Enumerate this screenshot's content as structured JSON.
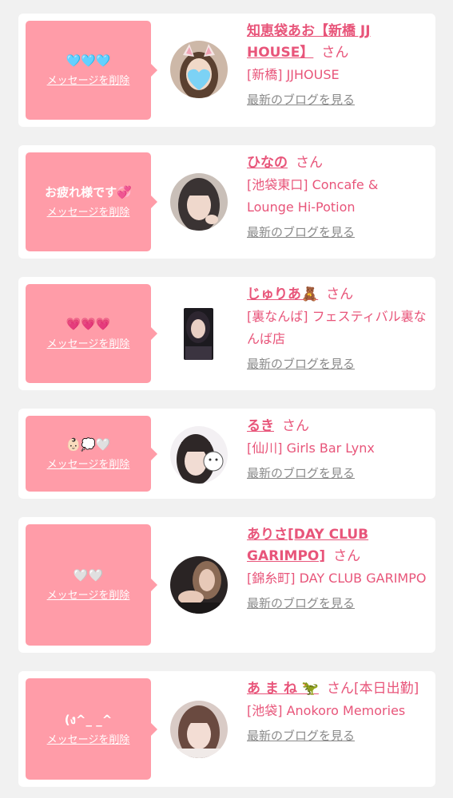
{
  "colors": {
    "accent_pink": "#e8557a",
    "bubble_pink": "#ff9ca8",
    "page_bg": "#f1f1f1",
    "link_gray": "#8a8a8a"
  },
  "labels": {
    "delete": "メッセージを削除",
    "blog": "最新のブログを見る",
    "honorific": "さん"
  },
  "items": [
    {
      "message": "🩵🩵🩵",
      "name": "知恵袋あお【新橋 JJ HOUSE】",
      "shop": "[新橋] JJHOUSE"
    },
    {
      "message": "お疲れ様です💞",
      "name": "ひなの",
      "shop": "[池袋東口] Concafe & Lounge Hi-Potion"
    },
    {
      "message": "💗💗💗",
      "name": "じゅりあ🧸",
      "shop": "[裏なんば] フェスティバル裏なんば店"
    },
    {
      "message": "👶🏻💭🤍",
      "name": "るき",
      "shop": "[仙川] Girls Bar Lynx"
    },
    {
      "message": "🤍🤍",
      "name": "ありさ[DAY CLUB GARIMPO]",
      "shop": "[錦糸町] DAY CLUB GARIMPO"
    },
    {
      "message": "(ง^_ _^",
      "name": "あ ま ね 🦖",
      "name_suffix": "[本日出勤]",
      "shop": "[池袋] Anokoro Memories"
    }
  ]
}
